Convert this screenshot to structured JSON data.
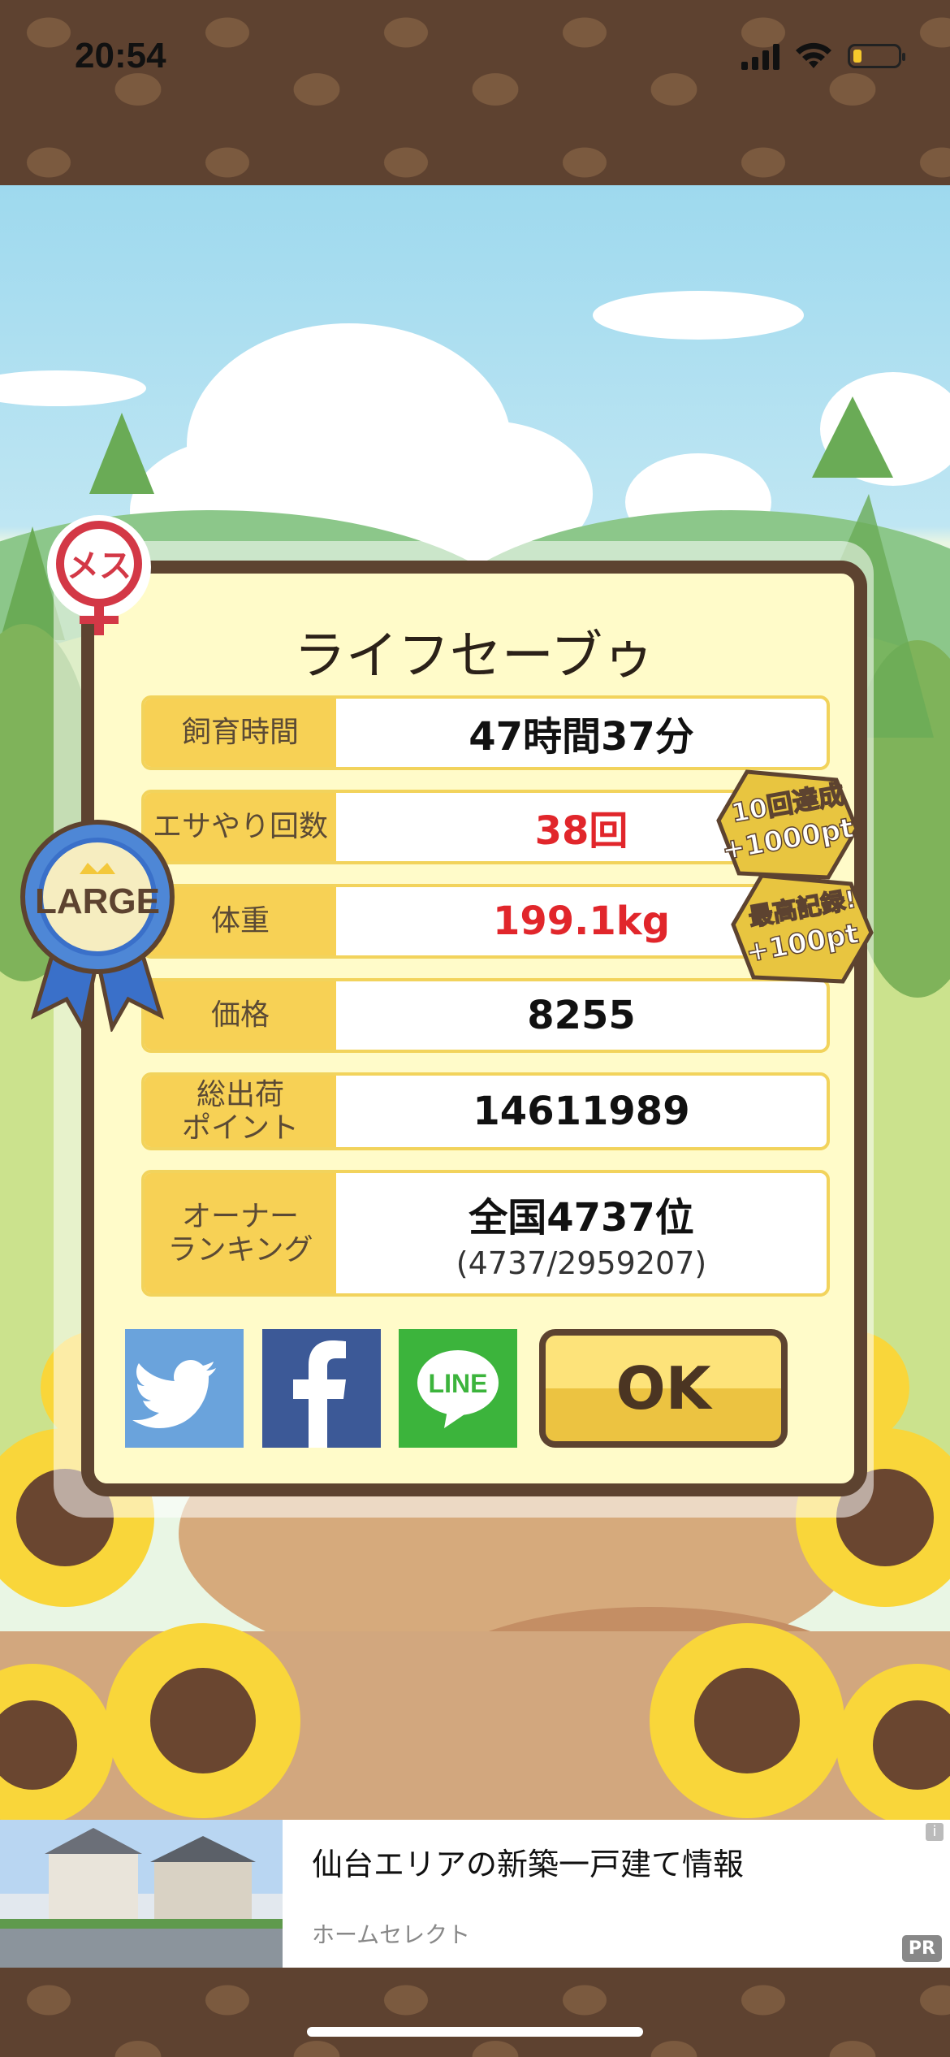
{
  "status_bar": {
    "time": "20:54"
  },
  "dialog": {
    "title": "ライフセーブゥ",
    "rows": [
      {
        "label": "飼育時間",
        "value": "47時間37分"
      },
      {
        "label": "エサやり回数",
        "value": "38回"
      },
      {
        "label": "体重",
        "value": "199.1kg"
      },
      {
        "label": "価格",
        "value": "8255"
      },
      {
        "label": "総出荷\nポイント",
        "value": "14611989"
      },
      {
        "label": "オーナー\nランキング",
        "value": "全国4737位",
        "sub": "(4737/2959207)"
      }
    ],
    "badges": {
      "gender": "メス",
      "size_ribbon": "LARGE",
      "bonus_feeding": {
        "line1": "10回達成",
        "line2": "+1000pt"
      },
      "bonus_weight": {
        "line1": "最高記録!",
        "line2": "+100pt"
      }
    },
    "buttons": {
      "line_label": "LINE",
      "ok_label": "OK"
    }
  },
  "ad": {
    "title": "仙台エリアの新築一戸建て情報",
    "sponsor": "ホームセレクト",
    "pr_label": "PR",
    "info_label": "i"
  },
  "colors": {
    "accent_red": "#e1262b",
    "label_yellow": "#f7d155",
    "frame_brown": "#5d4330"
  }
}
